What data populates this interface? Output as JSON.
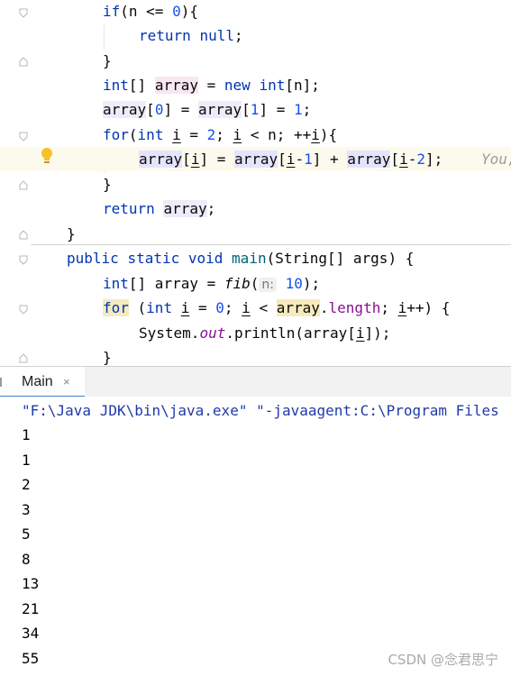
{
  "editor": {
    "lines": {
      "l1": {
        "kw_if": "if",
        "p1": "(n <= ",
        "num0": "0",
        "p2": "){"
      },
      "l2": {
        "kw_return": "return",
        "kw_null": "null",
        "p": ";"
      },
      "l3": {
        "brace": "}"
      },
      "l4": {
        "kw_int": "int",
        "brackets": "[] ",
        "var": "array",
        "eq": " = ",
        "kw_new": "new",
        "kw_int2": "int",
        "rest": "[n];"
      },
      "l5": {
        "a1": "array",
        "b1": "[",
        "n0": "0",
        "b2": "] = ",
        "a2": "array",
        "b3": "[",
        "n1": "1",
        "b4": "] = ",
        "n2": "1",
        "semi": ";"
      },
      "l6": {
        "kw_for": "for",
        "p1": "(",
        "kw_int": "int",
        "sp": " ",
        "i1": "i",
        "p2": " = ",
        "n2": "2",
        "p3": "; ",
        "i2": "i",
        "p4": " < n; ++",
        "i3": "i",
        "p5": "){"
      },
      "l7": {
        "a1": "array",
        "b1": "[",
        "i1": "i",
        "b2": "] = ",
        "a2": "array",
        "b3": "[",
        "i2": "i",
        "m1": "-",
        "n1": "1",
        "b4": "] + ",
        "a3": "array",
        "b5": "[",
        "i3": "i",
        "m2": "-",
        "n2": "2",
        "b6": "];",
        "hint": "You,"
      },
      "l8": {
        "brace": "}"
      },
      "l9": {
        "kw_return": "return",
        "sp": " ",
        "var": "array",
        "semi": ";"
      },
      "l10": {
        "brace": "}"
      },
      "l11": {
        "kw_public": "public",
        "kw_static": "static",
        "kw_void": "void",
        "fn_main": "main",
        "params": "(String[] args) {"
      },
      "l12": {
        "kw_int": "int",
        "p1": "[] array = ",
        "fn_fib": "fib",
        "p2": "(",
        "hint_n": "n:",
        "num10": "10",
        "p3": ");"
      },
      "l13": {
        "kw_for": "for",
        "p1": " (",
        "kw_int": "int",
        "sp": " ",
        "i1": "i",
        "p2": " = ",
        "n0": "0",
        "p3": "; ",
        "i2": "i",
        "p4": " < ",
        "a1": "array",
        "dot": ".",
        "len": "length",
        "p5": "; ",
        "i3": "i",
        "p6": "++) {"
      },
      "l14": {
        "p1": "System.",
        "out": "out",
        "p2": ".println(array[",
        "i1": "i",
        "p3": "]);"
      },
      "l15": {
        "brace": "}"
      }
    }
  },
  "run": {
    "tab_label": "Main",
    "close_glyph": "×"
  },
  "console": {
    "command": "\"F:\\Java JDK\\bin\\java.exe\" \"-javaagent:C:\\Program Files",
    "output": [
      "1",
      "1",
      "2",
      "3",
      "5",
      "8",
      "13",
      "21",
      "34",
      "55"
    ]
  },
  "watermark": "CSDN @念君思宁",
  "colors": {
    "keyword": "#0033b3",
    "number": "#1750eb",
    "field": "#871094",
    "function": "#00627a",
    "tab_underline": "#4083c9"
  },
  "icons": [
    "fold-marker-icon",
    "lightbulb-icon",
    "close-icon"
  ]
}
